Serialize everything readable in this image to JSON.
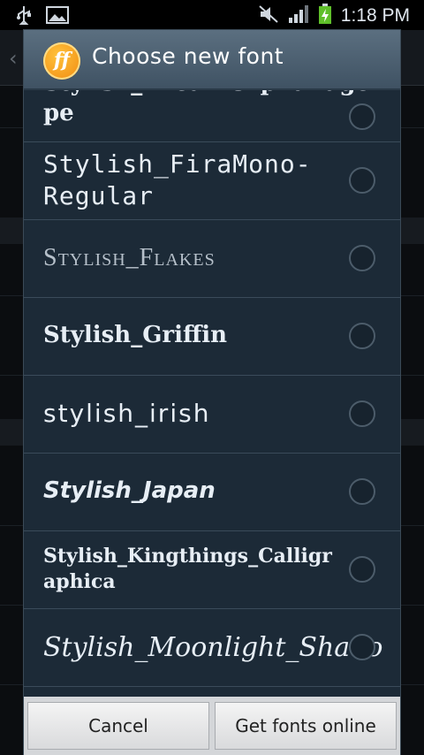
{
  "status_bar": {
    "time": "1:18 PM",
    "icons": [
      "usb-icon",
      "image-icon",
      "mute-icon",
      "signal-icon",
      "battery-charging-icon"
    ]
  },
  "dialog": {
    "logo_text": "ff",
    "title": "Choose new font",
    "fonts": [
      {
        "label": "Stylish_DreamOrphanage pe",
        "selected": false
      },
      {
        "label": "Stylish_FiraMono-Regular",
        "selected": false
      },
      {
        "label": "Stylish_Flakes",
        "selected": false
      },
      {
        "label": "Stylish_Griffin",
        "selected": false
      },
      {
        "label": "stylish_irish",
        "selected": false
      },
      {
        "label": "Stylish_Japan",
        "selected": false
      },
      {
        "label": "Stylish_Kingthings_Calligraphica",
        "selected": false
      },
      {
        "label": "Stylish_Moonlight_Shado",
        "selected": false
      }
    ],
    "buttons": {
      "cancel": "Cancel",
      "get_fonts": "Get fonts online"
    }
  }
}
